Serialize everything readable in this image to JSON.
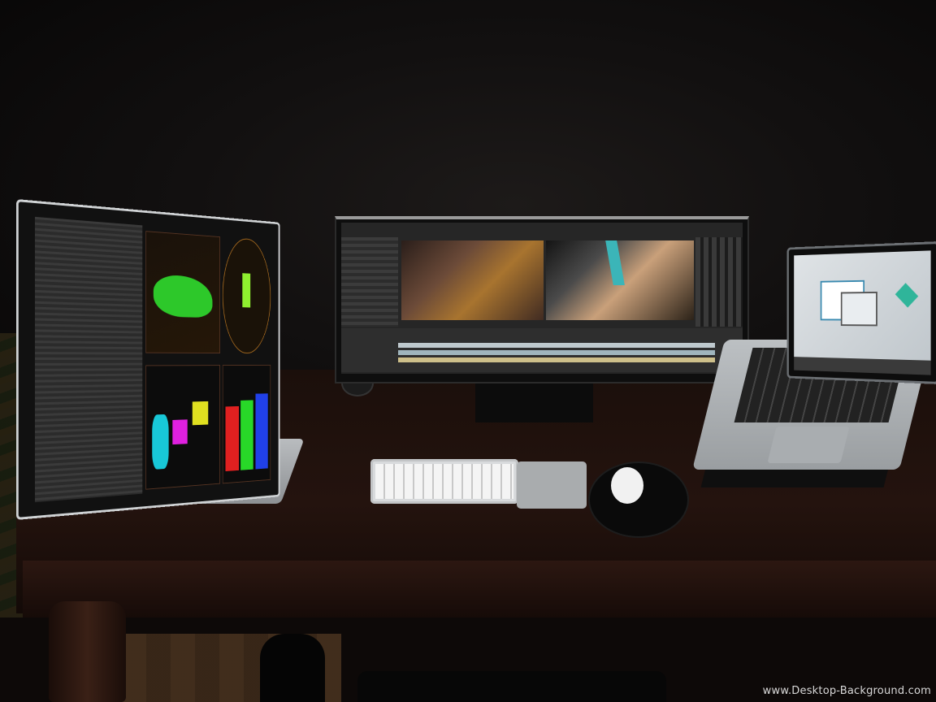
{
  "image": {
    "scene": "desk-workstation",
    "background_color": "#0b0a0a"
  },
  "watermark": {
    "text": "www.Desktop-Background.com"
  },
  "colors": {
    "scope_green": "#2fdc2f",
    "scope_cyan": "#18c8d8",
    "scope_magenta": "#e020e0",
    "scope_yellow": "#e0e020",
    "scope_red": "#e02020",
    "scope_blue": "#2040e8",
    "lanyard_teal": "#3bb5b8"
  }
}
